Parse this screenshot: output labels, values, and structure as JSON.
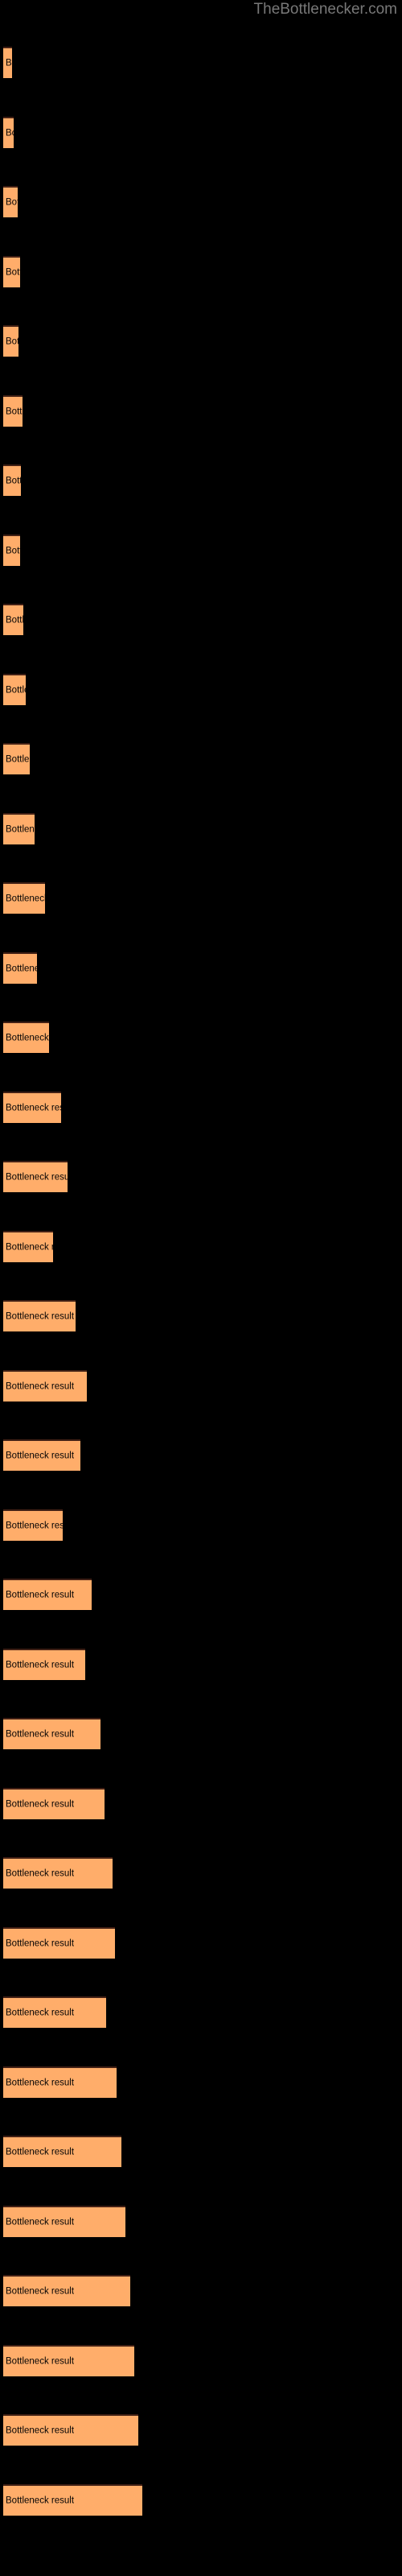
{
  "watermark": "TheBottlenecker.com",
  "chart_data": {
    "type": "bar",
    "orientation": "horizontal",
    "title": "",
    "subtitle": "",
    "xlabel": "",
    "ylabel": "",
    "grid": false,
    "legend": null,
    "background_color": "#000000",
    "bar_color": "#ffad6a",
    "bar_edge_color": "#412015",
    "label_color": "#050505",
    "watermark_color": "#787878",
    "bar_label_text": "Bottleneck result",
    "xlim": [
      0,
      500
    ],
    "categories": [
      "Bottleneck result",
      "Bottleneck result",
      "Bottleneck result",
      "Bottleneck result",
      "Bottleneck result",
      "Bottleneck result",
      "Bottleneck result",
      "Bottleneck result",
      "Bottleneck result",
      "Bottleneck result",
      "Bottleneck result",
      "Bottleneck result",
      "Bottleneck result",
      "Bottleneck result",
      "Bottleneck result",
      "Bottleneck result",
      "Bottleneck result",
      "Bottleneck result",
      "Bottleneck result",
      "Bottleneck result",
      "Bottleneck result",
      "Bottleneck result",
      "Bottleneck result",
      "Bottleneck result",
      "Bottleneck result",
      "Bottleneck result",
      "Bottleneck result",
      "Bottleneck result",
      "Bottleneck result",
      "Bottleneck result",
      "Bottleneck result",
      "Bottleneck result",
      "Bottleneck result",
      "Bottleneck result",
      "Bottleneck result",
      "Bottleneck result"
    ],
    "values": [
      11,
      13,
      18,
      21,
      19,
      24,
      22,
      21,
      25,
      28,
      33,
      39,
      52,
      42,
      57,
      72,
      80,
      62,
      90,
      104,
      96,
      74,
      110,
      102,
      121,
      126,
      136,
      139,
      128,
      141,
      147,
      152,
      158,
      163,
      168,
      173
    ],
    "bars": [
      {
        "y": 58,
        "h": 39,
        "w": 11,
        "label": "Bottleneck result"
      },
      {
        "y": 145,
        "h": 39,
        "w": 13,
        "label": "Bottleneck result"
      },
      {
        "y": 231,
        "h": 39,
        "w": 18,
        "label": "Bottleneck result"
      },
      {
        "y": 318,
        "h": 39,
        "w": 21,
        "label": "Bottleneck result"
      },
      {
        "y": 404,
        "h": 39,
        "w": 19,
        "label": "Bottleneck result"
      },
      {
        "y": 491,
        "h": 39,
        "w": 24,
        "label": "Bottleneck result"
      },
      {
        "y": 577,
        "h": 39,
        "w": 22,
        "label": "Bottleneck result"
      },
      {
        "y": 664,
        "h": 39,
        "w": 21,
        "label": "Bottleneck result"
      },
      {
        "y": 750,
        "h": 39,
        "w": 25,
        "label": "Bottleneck result"
      },
      {
        "y": 837,
        "h": 39,
        "w": 28,
        "label": "Bottleneck result"
      },
      {
        "y": 923,
        "h": 39,
        "w": 33,
        "label": "Bottleneck result"
      },
      {
        "y": 1010,
        "h": 39,
        "w": 39,
        "label": "Bottleneck result"
      },
      {
        "y": 1096,
        "h": 39,
        "w": 52,
        "label": "Bottleneck result"
      },
      {
        "y": 1183,
        "h": 39,
        "w": 42,
        "label": "Bottleneck result"
      },
      {
        "y": 1269,
        "h": 39,
        "w": 57,
        "label": "Bottleneck result"
      },
      {
        "y": 1356,
        "h": 39,
        "w": 72,
        "label": "Bottleneck result"
      },
      {
        "y": 1442,
        "h": 39,
        "w": 80,
        "label": "Bottleneck result"
      },
      {
        "y": 1529,
        "h": 39,
        "w": 62,
        "label": "Bottleneck result"
      },
      {
        "y": 1615,
        "h": 39,
        "w": 90,
        "label": "Bottleneck result"
      },
      {
        "y": 1702,
        "h": 39,
        "w": 104,
        "label": "Bottleneck result"
      },
      {
        "y": 1788,
        "h": 39,
        "w": 96,
        "label": "Bottleneck result"
      },
      {
        "y": 1875,
        "h": 39,
        "w": 74,
        "label": "Bottleneck result"
      },
      {
        "y": 1961,
        "h": 39,
        "w": 110,
        "label": "Bottleneck result"
      },
      {
        "y": 2048,
        "h": 39,
        "w": 102,
        "label": "Bottleneck result"
      },
      {
        "y": 2134,
        "h": 39,
        "w": 121,
        "label": "Bottleneck result"
      },
      {
        "y": 2221,
        "h": 39,
        "w": 126,
        "label": "Bottleneck result"
      },
      {
        "y": 2307,
        "h": 39,
        "w": 136,
        "label": "Bottleneck result"
      },
      {
        "y": 2394,
        "h": 39,
        "w": 139,
        "label": "Bottleneck result"
      },
      {
        "y": 2480,
        "h": 39,
        "w": 128,
        "label": "Bottleneck result"
      },
      {
        "y": 2567,
        "h": 39,
        "w": 141,
        "label": "Bottleneck result"
      },
      {
        "y": 2653,
        "h": 39,
        "w": 147,
        "label": "Bottleneck result"
      },
      {
        "y": 2740,
        "h": 39,
        "w": 152,
        "label": "Bottleneck result"
      },
      {
        "y": 2826,
        "h": 39,
        "w": 158,
        "label": "Bottleneck result"
      },
      {
        "y": 2913,
        "h": 39,
        "w": 163,
        "label": "Bottleneck result"
      },
      {
        "y": 2999,
        "h": 39,
        "w": 168,
        "label": "Bottleneck result"
      },
      {
        "y": 3086,
        "h": 39,
        "w": 173,
        "label": "Bottleneck result"
      }
    ]
  }
}
